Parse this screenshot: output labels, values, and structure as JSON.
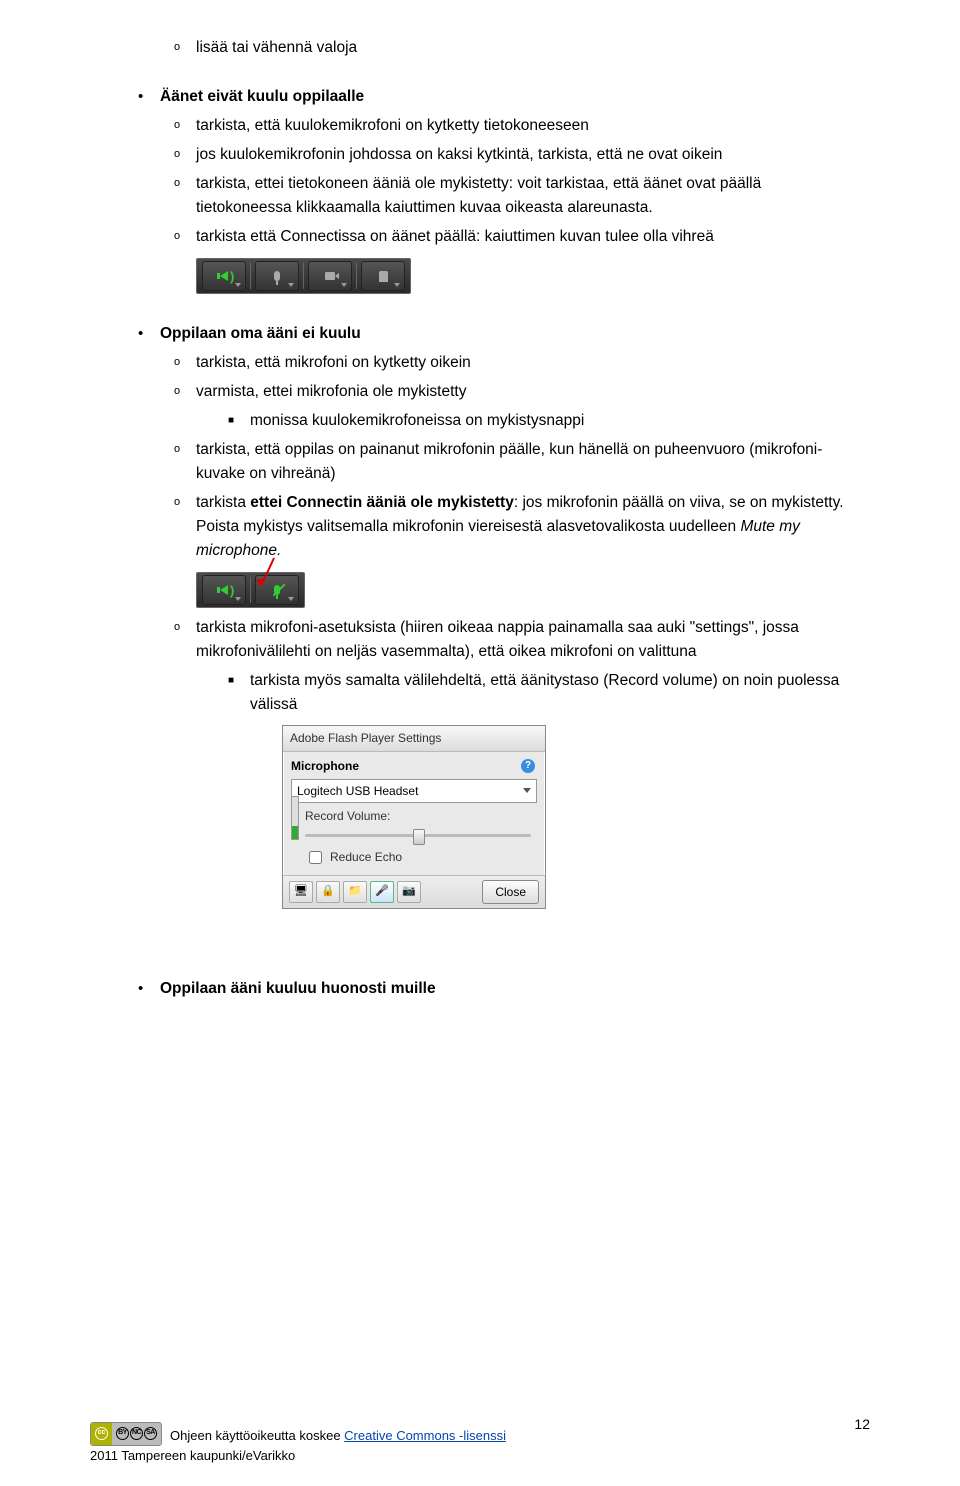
{
  "intro": {
    "i1": "lisää tai vähennä valoja"
  },
  "s1": {
    "head": "Äänet eivät kuulu oppilaalle",
    "a": "tarkista, että kuulokemikrofoni on kytketty tietokoneeseen",
    "b": "jos kuulokemikrofonin johdossa on kaksi kytkintä, tarkista, että ne ovat oikein",
    "c": "tarkista, ettei tietokoneen ääniä ole mykistetty: voit tarkistaa, että äänet ovat päällä tietokoneessa klikkaamalla kaiuttimen kuvaa oikeasta alareunasta.",
    "d": "tarkista että Connectissa on äänet päällä: kaiuttimen kuvan tulee olla vihreä"
  },
  "s2": {
    "head": "Oppilaan oma ääni ei kuulu",
    "a": "tarkista, että mikrofoni on kytketty oikein",
    "b": "varmista, ettei mikrofonia ole mykistetty",
    "b1": "monissa kuulokemikrofoneissa on mykistysnappi",
    "c": "tarkista, että oppilas on painanut mikrofonin päälle, kun hänellä on puheenvuoro (mikrofoni-kuvake on vihreänä)",
    "d_pre": "tarkista ",
    "d_bold": "ettei Connectin ääniä ole mykistetty",
    "d_post": ": jos mikrofonin päällä on viiva, se on mykistetty. Poista mykistys valitsemalla mikrofonin viereisestä alasvetovalikosta uudelleen ",
    "d_ital": "Mute my microphone.",
    "e": "tarkista mikrofoni-asetuksista (hiiren oikeaa nappia painamalla saa auki \"settings\", jossa mikrofonivälilehti on neljäs vasemmalta), että oikea mikrofoni on valittuna",
    "e1": "tarkista myös samalta välilehdeltä, että äänitystaso (Record volume) on noin puolessa välissä"
  },
  "s3": {
    "head": "Oppilaan ääni kuuluu huonosti muille"
  },
  "flash": {
    "title": "Adobe Flash Player Settings",
    "header": "Microphone",
    "device": "Logitech USB Headset",
    "rv": "Record Volume:",
    "reduce": "Reduce Echo",
    "close": "Close"
  },
  "footer": {
    "l1a": "Ohjeen käyttöoikeutta koskee ",
    "l1b": "Creative Commons -lisenssi",
    "l2": "2011 Tampereen kaupunki/eVarikko",
    "page": "12"
  }
}
